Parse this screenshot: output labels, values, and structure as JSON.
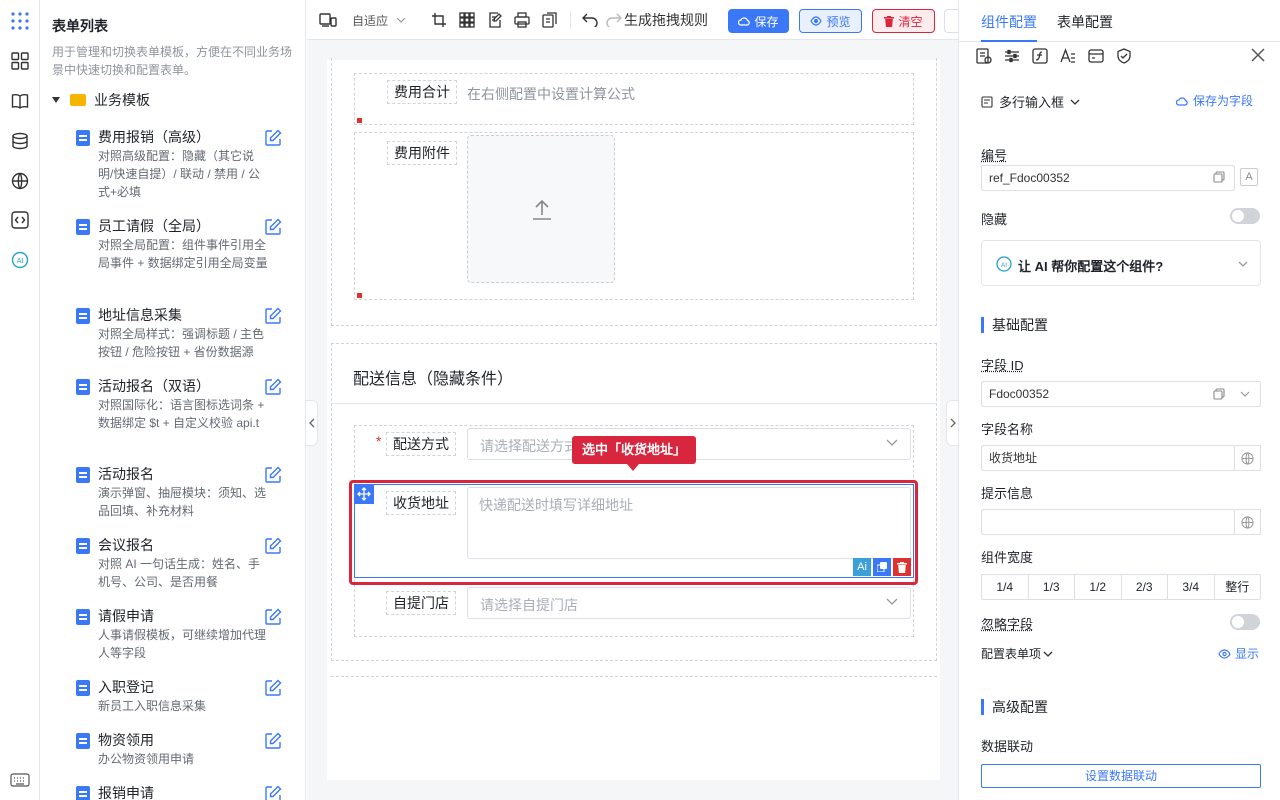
{
  "sidebar": {
    "title": "表单列表",
    "description": "用于管理和切换表单模板，方便在不同业务场景中快速切换和配置表单。",
    "group": "业务模板",
    "items": [
      {
        "name": "费用报销（高级）",
        "desc": "对照高级配置：隐藏（其它说明/快速自提）/ 联动 / 禁用 / 公式+必填"
      },
      {
        "name": "员工请假（全局）",
        "desc": "对照全局配置：组件事件引用全局事件 + 数据绑定引用全局变量"
      },
      {
        "name": "地址信息采集",
        "desc": "对照全局样式：强调标题 / 主色按钮 / 危险按钮 + 省份数据源"
      },
      {
        "name": "活动报名（双语）",
        "desc": "对照国际化：语言图标选词条 + 数据绑定 $t + 自定义校验 api.t"
      },
      {
        "name": "活动报名",
        "desc": "演示弹窗、抽屉模块：须知、选品回填、补充材料"
      },
      {
        "name": "会议报名",
        "desc": "对照 AI 一句话生成：姓名、手机号、公司、是否用餐"
      },
      {
        "name": "请假申请",
        "desc": "人事请假模板，可继续增加代理人等字段"
      },
      {
        "name": "入职登记",
        "desc": "新员工入职信息采集"
      },
      {
        "name": "物资领用",
        "desc": "办公物资领用申请"
      },
      {
        "name": "报销申请",
        "desc": ""
      }
    ]
  },
  "toolbar": {
    "adapt": "自适应",
    "rule": "生成拖拽规则",
    "save": "保存",
    "preview": "预览",
    "clear": "清空"
  },
  "form": {
    "fee_total_label": "费用合计",
    "fee_total_hint": "在右侧配置中设置计算公式",
    "fee_attach_label": "费用附件",
    "section_title": "配送信息（隐藏条件）",
    "delivery_required": "*",
    "delivery_label": "配送方式",
    "delivery_placeholder": "请选择配送方式",
    "address_label": "收货地址",
    "address_placeholder": "快递配送时填写详细地址",
    "store_label": "自提门店",
    "store_placeholder": "请选择自提门店",
    "tooltip": "选中「收货地址」",
    "ai_badge": "Ai"
  },
  "panel": {
    "tabs": [
      "组件配置",
      "表单配置"
    ],
    "component_type": "多行输入框",
    "save_as_field": "保存为字段",
    "id_label": "编号",
    "id_value": "ref_Fdoc00352",
    "hidden_label": "隐藏",
    "ai_prompt": "让 AI 帮你配置这个组件?",
    "basic_title": "基础配置",
    "field_id_label": "字段 ID",
    "field_id_value": "Fdoc00352",
    "field_name_label": "字段名称",
    "field_name_value": "收货地址",
    "hint_label": "提示信息",
    "hint_value": "",
    "width_label": "组件宽度",
    "widths": [
      "1/4",
      "1/3",
      "1/2",
      "2/3",
      "3/4",
      "整行"
    ],
    "ignore_label": "忽略字段",
    "form_item_label": "配置表单项",
    "show_label": "显示",
    "advanced_title": "高级配置",
    "linkage_label": "数据联动",
    "linkage_button": "设置数据联动"
  },
  "colors": {
    "accent": "#3b78f7",
    "danger": "#d9263f",
    "success": "#23a36b"
  }
}
